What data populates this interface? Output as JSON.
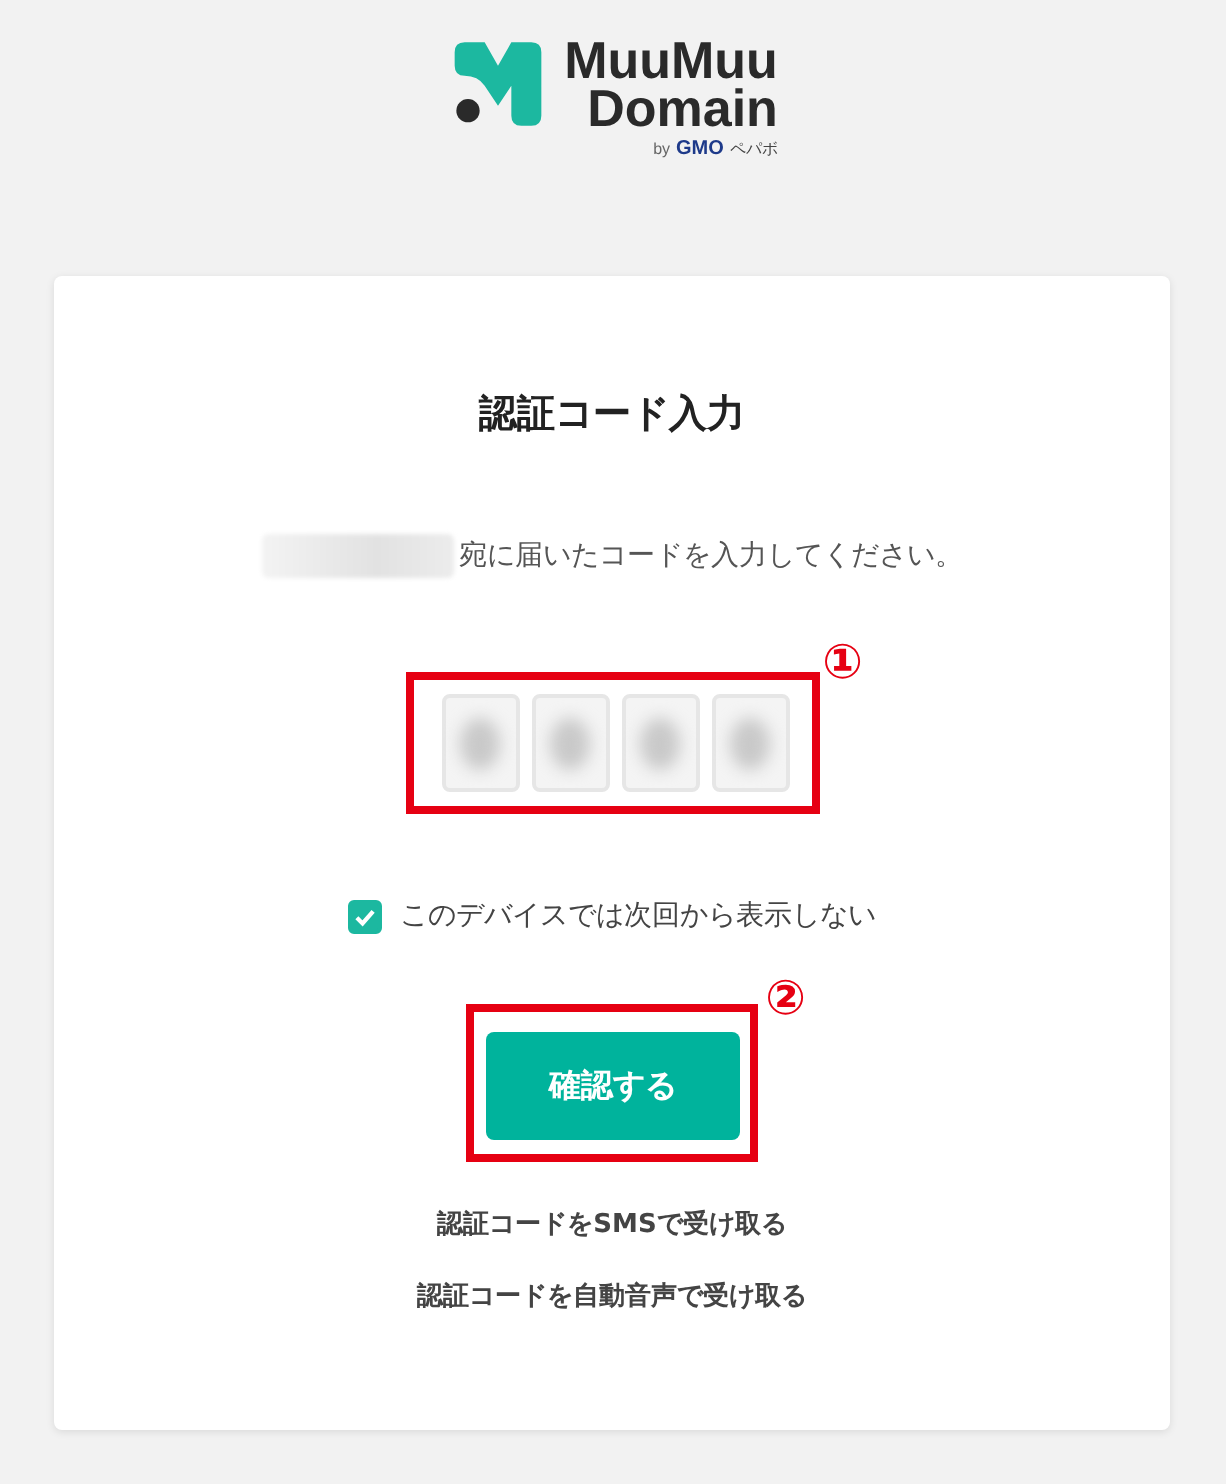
{
  "logo": {
    "line_1": "MuuMuu",
    "line_2": "Domain",
    "byline": "by",
    "brand": "GMO",
    "brand_suffix": "ペパボ"
  },
  "card": {
    "title": "認証コード入力",
    "recipient": {
      "redacted": true
    },
    "instruction": "宛に届いたコードを入力してください。",
    "code_fields": [
      {
        "redacted": true
      },
      {
        "redacted": true
      },
      {
        "redacted": true
      },
      {
        "redacted": true
      }
    ],
    "code_annotation": "①",
    "remember": {
      "label": "このデバイスでは次回から表示しない",
      "checked": true
    },
    "confirm_button": {
      "label": "確認する"
    },
    "button_annotation": "②",
    "links": [
      "認証コードをSMSで受け取る",
      "認証コードを自動音声で受け取る"
    ]
  }
}
